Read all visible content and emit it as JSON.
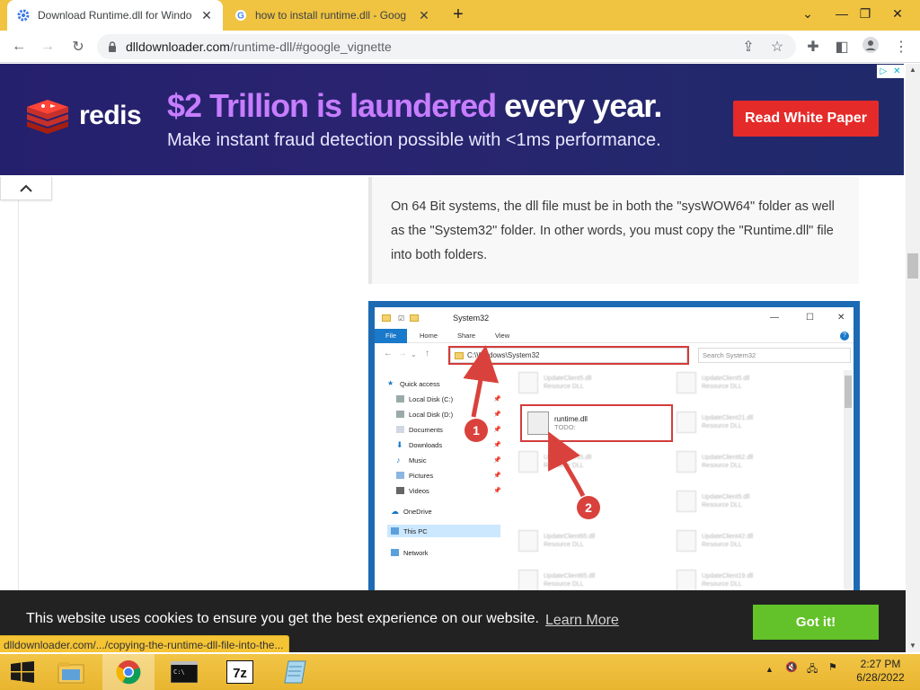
{
  "browser": {
    "tabs": [
      {
        "title": "Download Runtime.dll for Windo",
        "icon": "dll-downloader-gear-icon",
        "active": true
      },
      {
        "title": "how to install runtime.dll - Goog",
        "icon": "google-g-icon",
        "active": false
      }
    ],
    "new_tab_icon": "plus-icon",
    "window_controls": [
      "chevron-down-icon",
      "minimize-icon",
      "restore-icon",
      "close-icon"
    ],
    "url_host": "dlldownloader.com",
    "url_path": "/runtime-dll/#google_vignette"
  },
  "ad": {
    "logo_text": "redis",
    "headline_part1": "$2 Trillion is laundered",
    "headline_part2": " every year.",
    "subline": "Make instant fraud detection possible with <1ms performance.",
    "cta": "Read White Paper",
    "choices_icons": [
      "ad-choices-icon",
      "close-icon"
    ]
  },
  "article": {
    "paragraph": "On 64 Bit systems, the dll file must be in both the \"sysWOW64\" folder as well as the \"System32\" folder. In other words, you must copy the \"Runtime.dll\" file into both folders."
  },
  "explorer": {
    "window_title": "System32",
    "ribbon_tabs": [
      "File",
      "Home",
      "Share",
      "View"
    ],
    "address": "C:\\Windows\\System32",
    "search_placeholder": "Search System32",
    "tree": [
      {
        "label": "Quick access",
        "pinned": false
      },
      {
        "label": "Local Disk (C:)",
        "pinned": true
      },
      {
        "label": "Local Disk (D:)",
        "pinned": true
      },
      {
        "label": "Documents",
        "pinned": true
      },
      {
        "label": "Downloads",
        "pinned": true
      },
      {
        "label": "Music",
        "pinned": true
      },
      {
        "label": "Pictures",
        "pinned": true
      },
      {
        "label": "Videos",
        "pinned": true
      },
      {
        "label": "OneDrive",
        "pinned": false
      },
      {
        "label": "This PC",
        "pinned": false
      },
      {
        "label": "Network",
        "pinned": false
      }
    ],
    "highlight_file": {
      "name": "runtime.dll",
      "desc": "TODO:"
    },
    "background_files": [
      "UpdateClient5.dll",
      "UpdateClient5.dll",
      "UpdateClient21.dll",
      "UpdateClient62.dll",
      "UpdateClient5.dll",
      "UpdateClient5.dll",
      "UpdateClient65.dll",
      "UpdateClient42.dll",
      "UpdateClient65.dll",
      "UpdateClient19.dll"
    ],
    "background_file_desc": "Resource DLL",
    "step_badges": [
      "1",
      "2"
    ]
  },
  "cookie": {
    "message": "This website uses cookies to ensure you get the best experience on our website.",
    "link": "Learn More",
    "button": "Got it!"
  },
  "status_url": "dlldownloader.com/.../copying-the-runtime-dll-file-into-the...",
  "taskbar": {
    "apps": [
      "windows-start-icon",
      "file-explorer-icon",
      "chrome-icon",
      "command-prompt-icon",
      "7zip-icon",
      "notepad-icon"
    ],
    "tray_icons": [
      "show-hidden-icons-arrow",
      "volume-muted-icon",
      "network-icon",
      "action-center-icon"
    ],
    "time": "2:27 PM",
    "date": "6/28/2022"
  },
  "colors": {
    "chrome_frame": "#f0c341",
    "ad_bg": "#25206d",
    "ad_accent": "#c77dff",
    "ad_cta": "#e52a2a",
    "cookie_btn": "#63c229",
    "highlight_red": "#d43c3c"
  }
}
